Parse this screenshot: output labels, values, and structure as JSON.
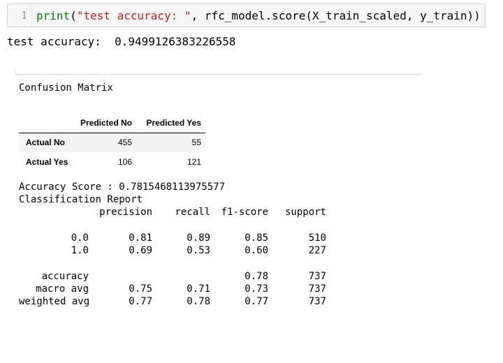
{
  "code_cell": {
    "line_number": "1",
    "tokens": {
      "func": "print",
      "open": "(",
      "string": "\"test accuracy: \"",
      "rest": ", rfc_model.score(X_train_scaled, y_train))"
    }
  },
  "stdout": {
    "text": "test accuracy:  0.9499126383226558"
  },
  "output": {
    "cm_title": "Confusion Matrix",
    "confusion_matrix": {
      "columns": [
        "Predicted No",
        "Predicted Yes"
      ],
      "rows": [
        {
          "label": "Actual No",
          "values": [
            "455",
            "55"
          ]
        },
        {
          "label": "Actual Yes",
          "values": [
            "106",
            "121"
          ]
        }
      ]
    },
    "accuracy_score": "Accuracy Score : 0.7815468113975577",
    "report_title": "Classification Report",
    "report": {
      "header": [
        "precision",
        "recall",
        "f1-score",
        "support"
      ],
      "rows": [
        {
          "label": "0.0",
          "precision": "0.81",
          "recall": "0.89",
          "f1": "0.85",
          "support": "510"
        },
        {
          "label": "1.0",
          "precision": "0.69",
          "recall": "0.53",
          "f1": "0.60",
          "support": "227"
        },
        {
          "label": "accuracy",
          "precision": "",
          "recall": "",
          "f1": "0.78",
          "support": "737"
        },
        {
          "label": "macro avg",
          "precision": "0.75",
          "recall": "0.71",
          "f1": "0.73",
          "support": "737"
        },
        {
          "label": "weighted avg",
          "precision": "0.77",
          "recall": "0.78",
          "f1": "0.77",
          "support": "737"
        }
      ]
    }
  },
  "colors": {
    "builtin": "#008000",
    "string": "#ba2121",
    "cell_background": "#f7f7f7"
  }
}
